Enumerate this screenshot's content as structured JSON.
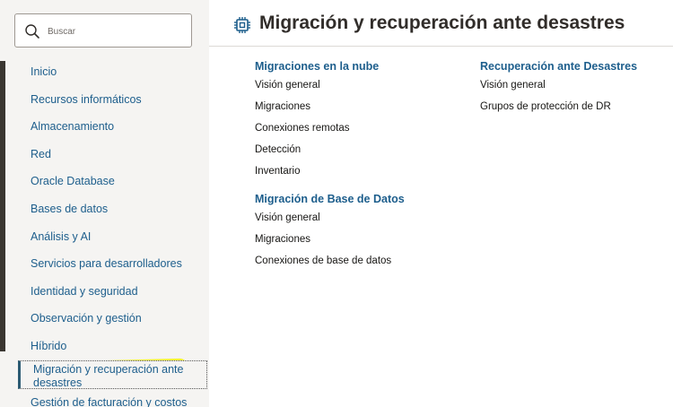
{
  "sidebar": {
    "search": {
      "placeholder": "Buscar"
    },
    "items": [
      {
        "label": "Inicio"
      },
      {
        "label": "Recursos informáticos"
      },
      {
        "label": "Almacenamiento"
      },
      {
        "label": "Red"
      },
      {
        "label": "Oracle Database"
      },
      {
        "label": "Bases de datos"
      },
      {
        "label": "Análisis y AI"
      },
      {
        "label": "Servicios para desarrolladores"
      },
      {
        "label": "Identidad y seguridad"
      },
      {
        "label": "Observación y gestión"
      },
      {
        "label": "Híbrido"
      },
      {
        "label": "Migración y recuperación ante desastres"
      },
      {
        "label": "Gestión de facturación y costos"
      }
    ],
    "active_index": 11
  },
  "main": {
    "icon": "chip-icon",
    "title": "Migración y recuperación ante desastres",
    "groups": {
      "cloud_migrations": {
        "title": "Migraciones en la nube",
        "links": [
          "Visión general",
          "Migraciones",
          "Conexiones remotas",
          "Detección",
          "Inventario"
        ]
      },
      "db_migration": {
        "title": "Migración de Base de Datos",
        "links": [
          "Visión general",
          "Migraciones",
          "Conexiones de base de datos"
        ]
      },
      "disaster_recovery": {
        "title": "Recuperación ante Desastres",
        "links": [
          "Visión general",
          "Grupos de protección de DR"
        ]
      }
    }
  },
  "colors": {
    "link_blue": "#1d5e8c",
    "highlight_yellow": "#f7f427",
    "sidebar_bg": "#f5f4f2"
  }
}
